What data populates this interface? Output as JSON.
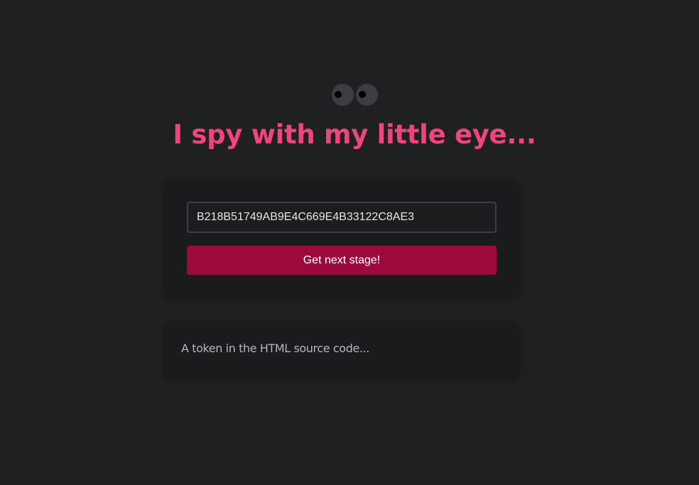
{
  "header": {
    "icon": "eyes-icon",
    "title": "I spy with my little eye..."
  },
  "form": {
    "token_value": "B218B51749AB9E4C669E4B33122C8AE3",
    "submit_label": "Get next stage!"
  },
  "hint": {
    "text": "A token in the HTML source code..."
  },
  "colors": {
    "background": "#1e2022",
    "title": "#f0447c",
    "button": "#9c0a3d",
    "card": "#1a1b1c"
  }
}
